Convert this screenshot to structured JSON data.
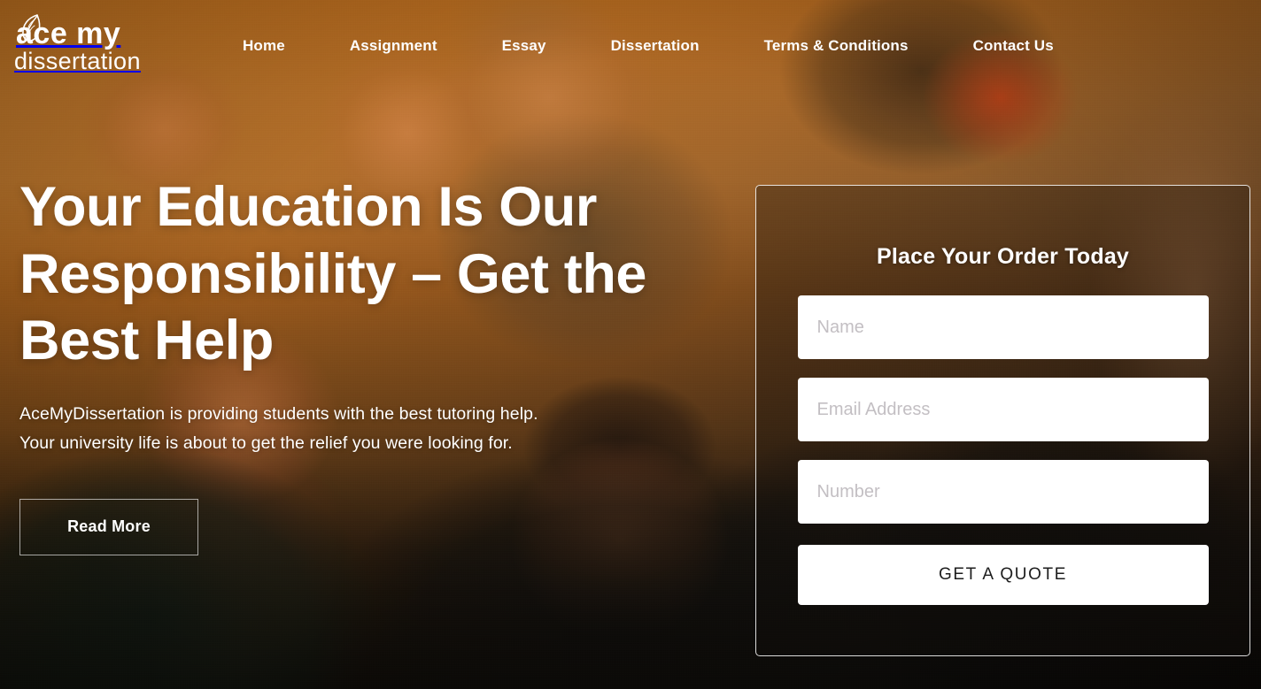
{
  "brand": {
    "logo_line1": "ace my",
    "logo_line2": "dissertation",
    "icon": "quill-feather-icon"
  },
  "nav": {
    "items": [
      {
        "label": "Home"
      },
      {
        "label": "Assignment"
      },
      {
        "label": "Essay"
      },
      {
        "label": "Dissertation"
      },
      {
        "label": "Terms & Conditions"
      },
      {
        "label": "Contact Us"
      }
    ]
  },
  "hero": {
    "title": "Your Education Is Our Responsibility – Get the Best Help",
    "subtitle_line1": "AceMyDissertation is providing students with the best tutoring help.",
    "subtitle_line2": "Your university life is about to get the relief you were looking for.",
    "cta_label": "Read More"
  },
  "order_form": {
    "title": "Place Your Order Today",
    "fields": [
      {
        "name": "name",
        "value": "",
        "placeholder": "Name"
      },
      {
        "name": "email",
        "value": "",
        "placeholder": "Email Address"
      },
      {
        "name": "number",
        "value": "",
        "placeholder": "Number"
      }
    ],
    "submit_label": "GET A QUOTE"
  },
  "colors": {
    "background_warm": "#a9641f",
    "background_dark": "#20160f",
    "text_light": "#ffffff",
    "field_background": "#ffffff",
    "placeholder": "#c3bfc3",
    "button_text_dark": "#1d1d1d"
  }
}
